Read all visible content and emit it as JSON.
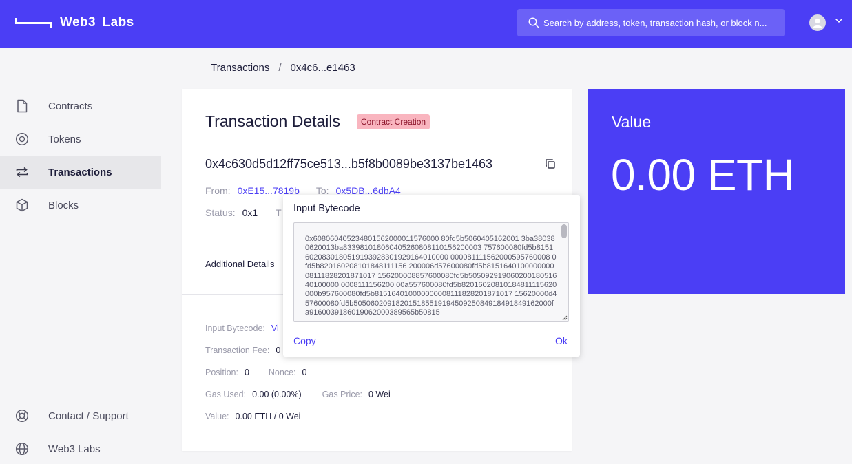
{
  "header": {
    "brand": "Web3 Labs",
    "search_placeholder": "Search by address, token, transaction hash, or block n..."
  },
  "sidebar": {
    "items": [
      {
        "label": "Contracts",
        "icon": "document-icon"
      },
      {
        "label": "Tokens",
        "icon": "token-icon"
      },
      {
        "label": "Transactions",
        "icon": "transfer-icon",
        "active": true
      },
      {
        "label": "Blocks",
        "icon": "cube-icon"
      }
    ],
    "footer": [
      {
        "label": "Contact / Support",
        "icon": "lifebuoy-icon"
      },
      {
        "label": "Web3 Labs",
        "icon": "globe-icon"
      }
    ]
  },
  "breadcrumb": {
    "parent": "Transactions",
    "separator": "/",
    "current": "0x4c6...e1463"
  },
  "transaction": {
    "title": "Transaction Details",
    "badge": "Contract Creation",
    "hash": "0x4c630d5d12ff75ce513...b5f8b0089be3137be1463",
    "from_label": "From:",
    "from": "0xE15...7819b",
    "to_label": "To:",
    "to": "0x5DB...6dbA4",
    "status_label": "Status:",
    "status": "0x1",
    "status_hidden_label": "T",
    "additional_tab": "Additional Details",
    "details": {
      "input_bytecode_label": "Input Bytecode:",
      "input_bytecode_link": "Vi",
      "fee_label": "Transaction Fee:",
      "fee_value": "0",
      "position_label": "Position:",
      "position_value": "0",
      "nonce_label": "Nonce:",
      "nonce_value": "0",
      "gas_used_label": "Gas Used:",
      "gas_used_value": "0.00 (0.00%)",
      "gas_price_label": "Gas Price:",
      "gas_price_value": "0 Wei",
      "value_label": "Value:",
      "value_value": "0.00 ETH / 0 Wei"
    }
  },
  "value_card": {
    "label": "Value",
    "amount": "0.00 ETH"
  },
  "popover": {
    "title": "Input Bytecode",
    "bytecode": "0x608060405234801562000011576000 80fd5b5060405162001 3ba380380620013ba833981018060405260808110156200003 757600080fd5b81516020830180519193928301929164010000 000081111562000595760008 0fd5b820160208101848111156 200006d57600080fd5b815164010000000008111828201871017 156200008857600080fd5b50509291906020018051640100000 0008111156200 00a557600080fd5b82016020810184811115620000b957600080fd5b815164010000000008111828201871017 15620000d457600080fd5b50506020918201518551919450925084918491849162000fa9160039186019062000389565b50815",
    "copy_label": "Copy",
    "ok_label": "Ok"
  }
}
